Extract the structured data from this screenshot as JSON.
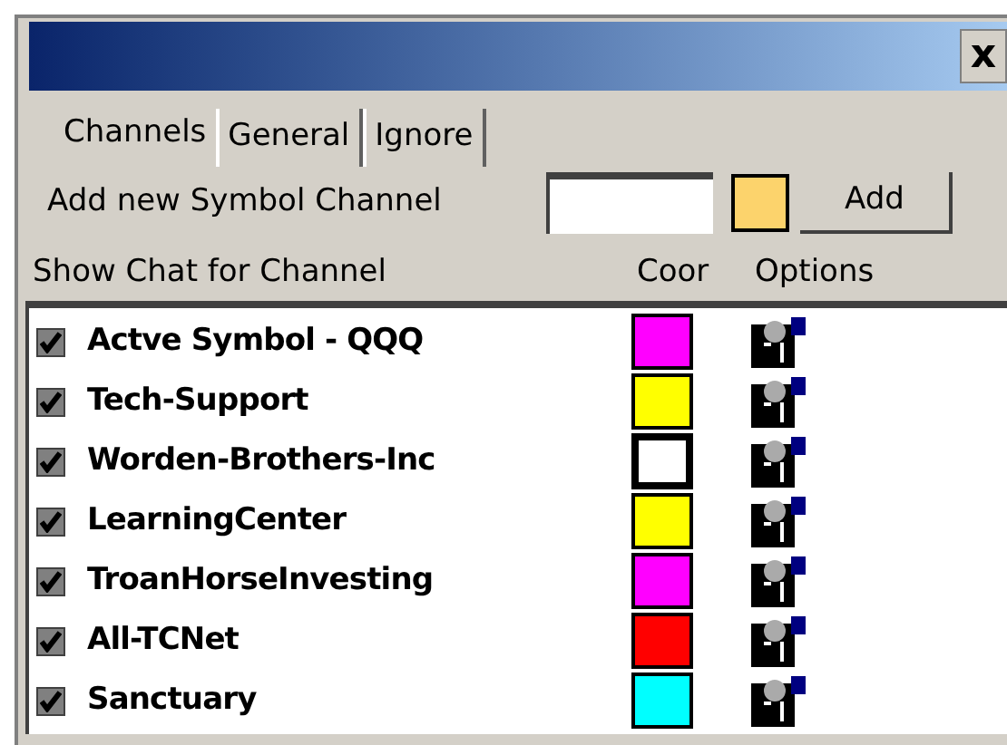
{
  "window": {
    "close_label": "x"
  },
  "tabs": [
    {
      "label": "Channels",
      "selected": true
    },
    {
      "label": "General",
      "selected": false
    },
    {
      "label": "Ignore",
      "selected": false
    }
  ],
  "add_channel": {
    "label": "Add new Symbol Channel",
    "color": "#fcd36c",
    "button": "Add"
  },
  "list": {
    "columns": [
      "Show Chat for Channel",
      "Coor",
      "Options"
    ],
    "rows": [
      {
        "name": "Actve Symbol - QQQ",
        "checked": true,
        "color": "#ff00ff",
        "selected": false
      },
      {
        "name": "Tech-Support",
        "checked": true,
        "color": "#ffff00",
        "selected": false
      },
      {
        "name": "Worden-Brothers-Inc",
        "checked": true,
        "color": "#ffffff",
        "selected": true
      },
      {
        "name": "LearningCenter",
        "checked": true,
        "color": "#ffff00",
        "selected": false
      },
      {
        "name": "TroanHorseInvesting",
        "checked": true,
        "color": "#ff00ff",
        "selected": false
      },
      {
        "name": "All-TCNet",
        "checked": true,
        "color": "#ff0000",
        "selected": false
      },
      {
        "name": "Sanctuary",
        "checked": true,
        "color": "#00ffff",
        "selected": false
      }
    ]
  }
}
